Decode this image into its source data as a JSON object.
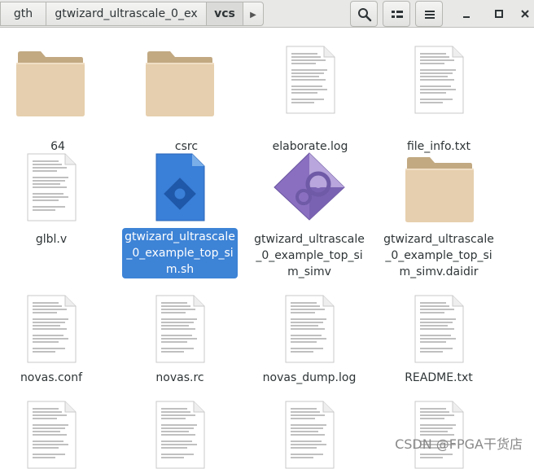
{
  "breadcrumbs": [
    "gth",
    "gtwizard_ultrascale_0_ex",
    "vcs"
  ],
  "window": {
    "search_icon": "search-icon",
    "view_icon": "view-options-icon",
    "menu_icon": "hamburger-menu-icon"
  },
  "files": [
    {
      "name": "64",
      "type": "folder"
    },
    {
      "name": "csrc",
      "type": "folder"
    },
    {
      "name": "elaborate.log",
      "type": "text"
    },
    {
      "name": "file_info.txt",
      "type": "text"
    },
    {
      "name": "glbl.v",
      "type": "text"
    },
    {
      "name": "gtwizard_ultrascale_0_example_top_sim.sh",
      "type": "script",
      "selected": true
    },
    {
      "name": "gtwizard_ultrascale_0_example_top_sim_simv",
      "type": "executable"
    },
    {
      "name": "gtwizard_ultrascale_0_example_top_sim_simv.daidir",
      "type": "folder"
    },
    {
      "name": "novas.conf",
      "type": "text"
    },
    {
      "name": "novas.rc",
      "type": "text"
    },
    {
      "name": "novas_dump.log",
      "type": "text"
    },
    {
      "name": "README.txt",
      "type": "text"
    },
    {
      "name": "",
      "type": "text"
    },
    {
      "name": "",
      "type": "text"
    },
    {
      "name": "",
      "type": "text"
    },
    {
      "name": "",
      "type": "text"
    }
  ],
  "labels": {
    "f0": "64",
    "f1": "csrc",
    "f2": "elaborate.log",
    "f3": "file_info.txt",
    "f4": "glbl.v",
    "f5": "gtwizard_ultrascale_0_example_top_sim.sh",
    "f6": "gtwizard_ultrascale_0_example_top_sim_simv",
    "f7": "gtwizard_ultrascale_0_example_top_sim_simv.daidir",
    "f8": "novas.conf",
    "f9": "novas.rc",
    "f10": "novas_dump.log",
    "f11": "README.txt"
  },
  "watermark": "CSDN @FPGA干货店",
  "colors": {
    "selection": "#3d83d6",
    "folder": "#e3ccab",
    "folder_tab": "#c8b08a"
  }
}
